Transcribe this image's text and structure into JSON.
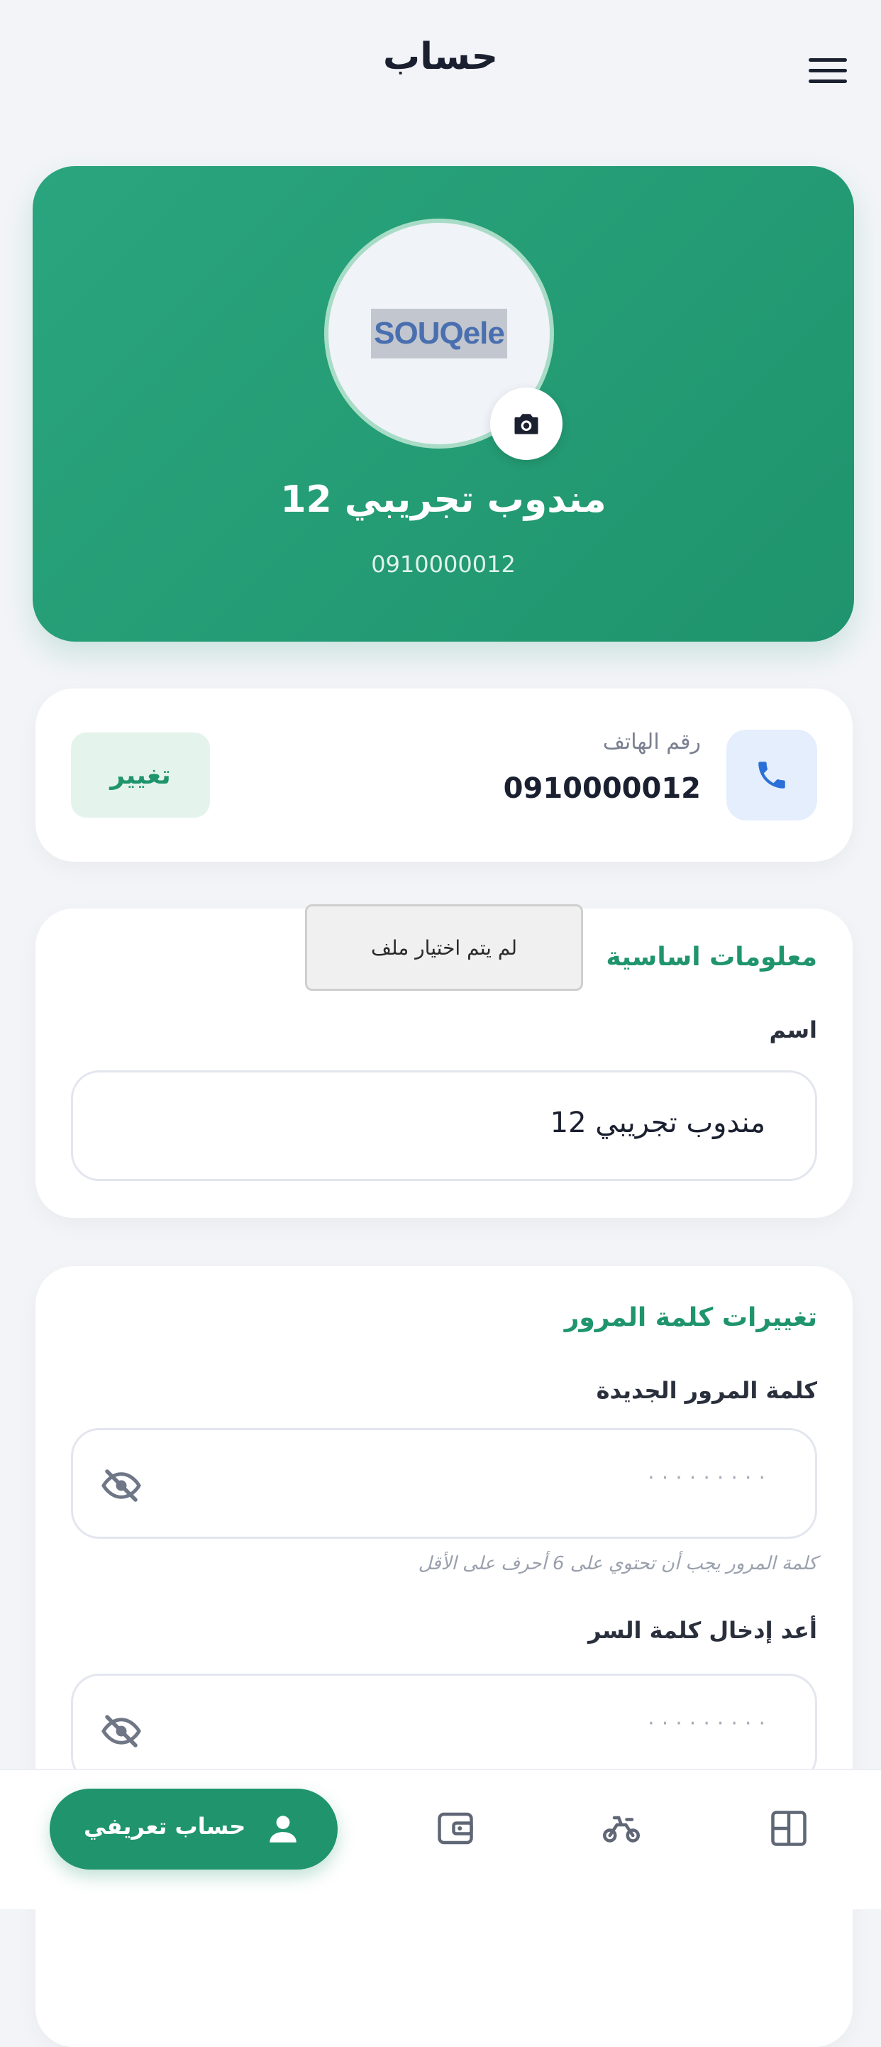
{
  "header": {
    "title": "حساب"
  },
  "profile": {
    "logo_text": "SOUQele",
    "name": "مندوب تجريبي 12",
    "phone": "0910000012"
  },
  "phone_card": {
    "label": "رقم الهاتف",
    "value": "0910000012",
    "change_label": "تغيير"
  },
  "basic_info": {
    "title": "معلومات اساسية",
    "name_label": "اسم",
    "name_value": "مندوب تجريبي 12"
  },
  "tooltip": {
    "text": "لم يتم اختيار ملف"
  },
  "password_section": {
    "title": "تغييرات كلمة المرور",
    "new_password_label": "كلمة المرور الجديدة",
    "new_password_value": "·········",
    "hint": "كلمة المرور يجب أن تحتوي على 6 أحرف على الأقل",
    "confirm_label": "أعد إدخال كلمة السر",
    "confirm_value": "·········"
  },
  "bottom_nav": {
    "active_label": "حساب تعريفي",
    "items": [
      "user-icon",
      "wallet-icon",
      "motorcycle-icon",
      "dashboard-icon"
    ]
  },
  "colors": {
    "accent": "#1f946d",
    "accent_light": "#e4f4ec",
    "phone_icon_bg": "#e5eefc",
    "phone_icon": "#2b6fd8"
  }
}
